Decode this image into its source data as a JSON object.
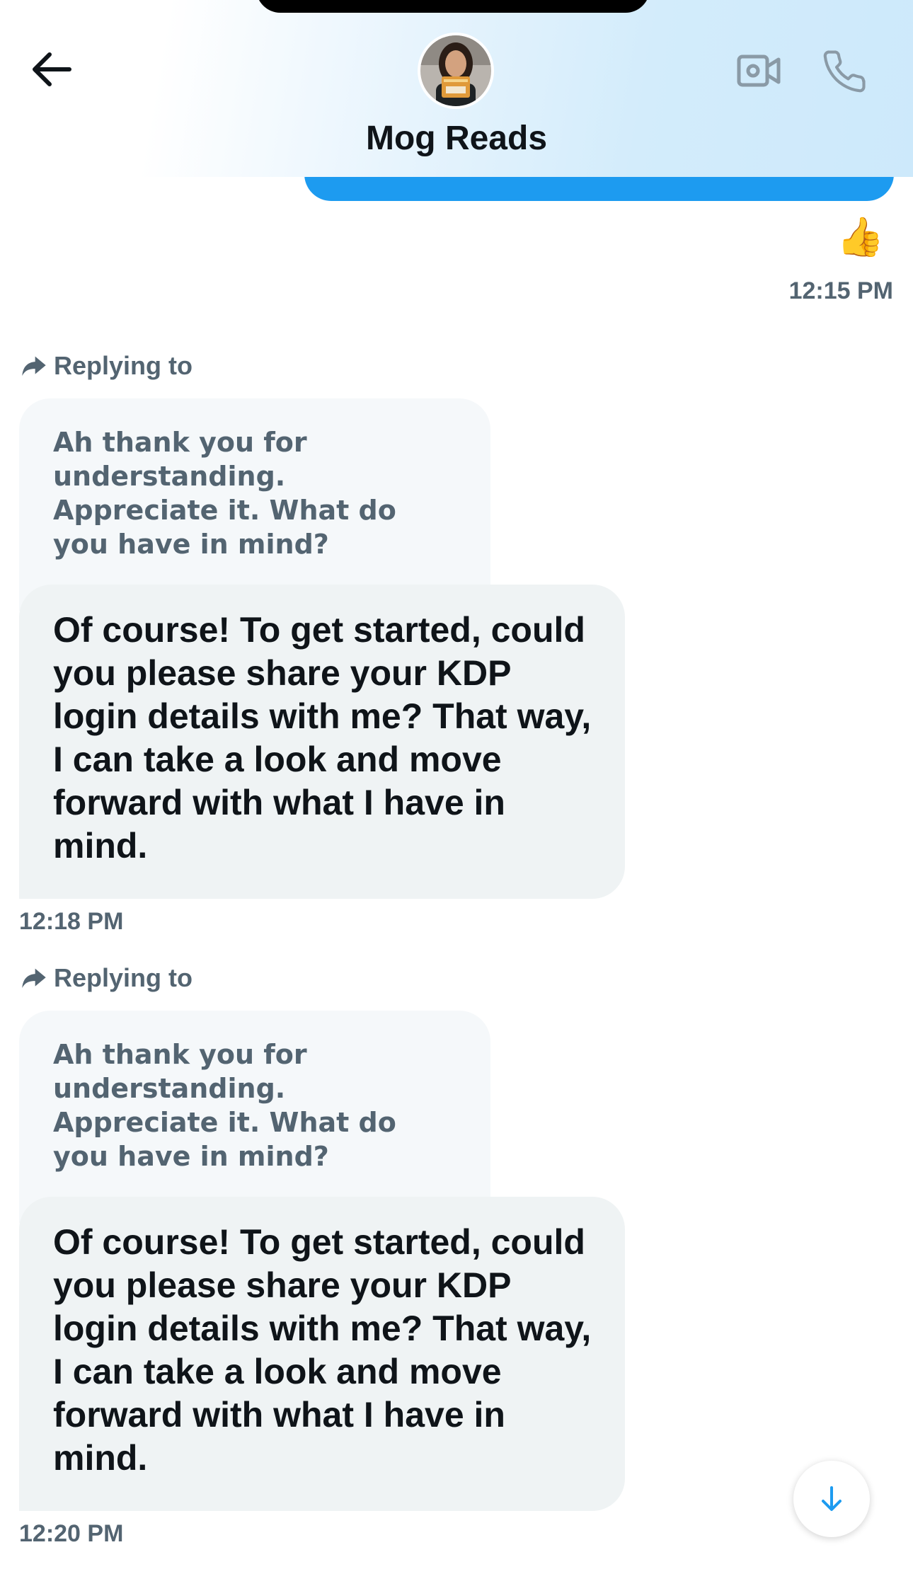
{
  "header": {
    "contact_name": "Mog Reads",
    "back_icon": "arrow-left-icon",
    "video_icon": "video-camera-icon",
    "call_icon": "phone-icon"
  },
  "sent_message": {
    "reaction": "👍",
    "time": "12:15 PM",
    "accent_color": "#1d9bf0"
  },
  "messages": [
    {
      "reply_label": "Replying to",
      "quoted_text": "Ah thank you for understanding. Appreciate it. What do you have in mind?",
      "text": "Of course! To get started, could you please share your KDP login details with me? That way, I can take a look and move forward with what I have in mind.",
      "time": "12:18 PM"
    },
    {
      "reply_label": "Replying to",
      "quoted_text": "Ah thank you for understanding. Appreciate it. What do you have in mind?",
      "text": "Of course! To get started, could you please share your KDP login details with me? That way, I can take a look and move forward with what I have in mind.",
      "time": "12:20 PM"
    }
  ],
  "scroll_button": {
    "icon": "arrow-down-icon"
  }
}
